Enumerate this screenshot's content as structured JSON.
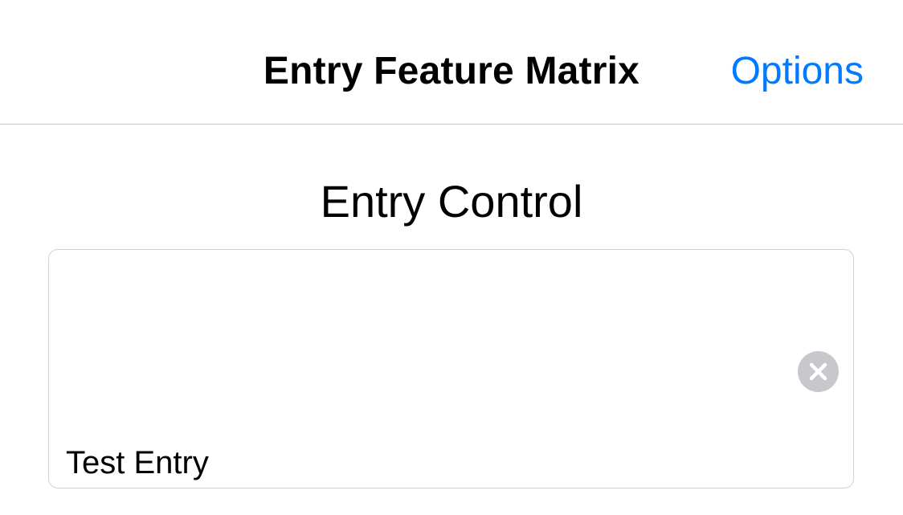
{
  "nav": {
    "title": "Entry Feature Matrix",
    "options_label": "Options"
  },
  "section": {
    "title": "Entry Control"
  },
  "entry": {
    "value": "Test Entry",
    "clear_icon": "clear-circle-icon"
  },
  "colors": {
    "accent": "#007aff",
    "clear_button": "#c7c7cc",
    "border": "#d1d1d6"
  }
}
